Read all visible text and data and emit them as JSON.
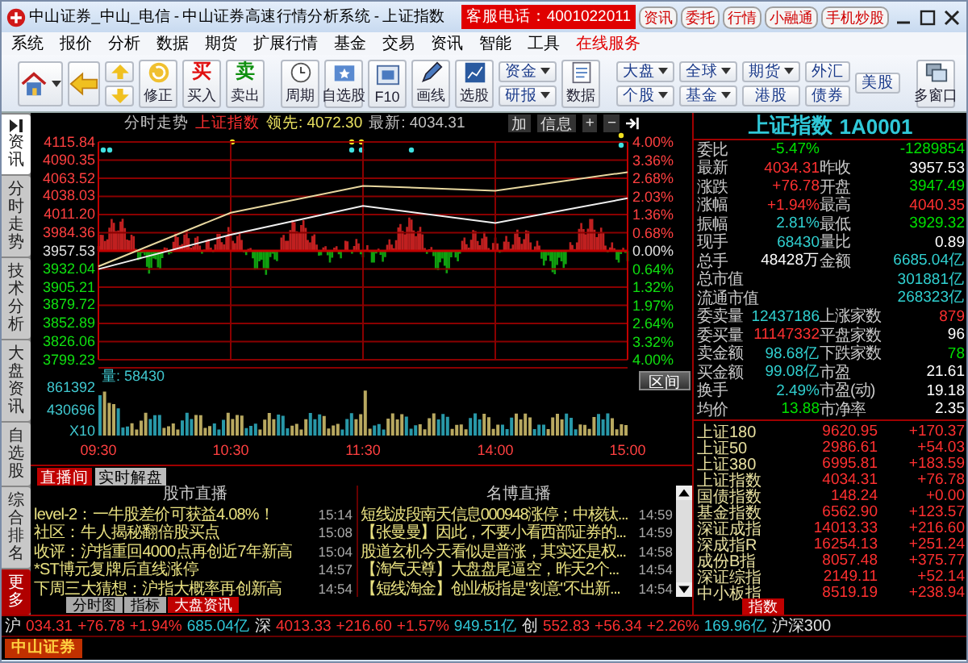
{
  "window": {
    "title": "中山证券_中山_电信 - 中山证券高速行情分析系统 - 上证指数",
    "hotline": "客服电话：4001022011",
    "quick_buttons": [
      "资讯",
      "委托",
      "行情",
      "小融通",
      "手机炒股"
    ]
  },
  "menu": [
    {
      "label": "系统",
      "kind": "normal"
    },
    {
      "label": "报价",
      "kind": "normal"
    },
    {
      "label": "分析",
      "kind": "normal"
    },
    {
      "label": "数据",
      "kind": "normal"
    },
    {
      "label": "期货",
      "kind": "normal"
    },
    {
      "label": "扩展行情",
      "kind": "normal"
    },
    {
      "label": "基金",
      "kind": "normal"
    },
    {
      "label": "交易",
      "kind": "normal"
    },
    {
      "label": "资讯",
      "kind": "normal"
    },
    {
      "label": "智能",
      "kind": "normal"
    },
    {
      "label": "工具",
      "kind": "normal"
    },
    {
      "label": "在线服务",
      "kind": "highlight"
    }
  ],
  "toolbar": [
    {
      "kind": "home"
    },
    {
      "kind": "back"
    },
    {
      "kind": "updown"
    },
    {
      "kind": "labeled",
      "label": "修正"
    },
    {
      "kind": "trade",
      "glyph": "买",
      "label": "买入",
      "color": "#e01010"
    },
    {
      "kind": "trade",
      "glyph": "卖",
      "label": "卖出",
      "color": "#109010"
    },
    {
      "kind": "separator"
    },
    {
      "kind": "labeled",
      "label": "周期"
    },
    {
      "kind": "labeled",
      "label": "自选股"
    },
    {
      "kind": "labeled",
      "label": "F10"
    },
    {
      "kind": "labeled",
      "label": "画线"
    },
    {
      "kind": "labeled",
      "label": "选股"
    },
    {
      "kind": "pair",
      "items": [
        {
          "label": "资金",
          "dropdown": true
        },
        {
          "label": "研报",
          "dropdown": true
        }
      ]
    },
    {
      "kind": "labeled",
      "label": "数据"
    },
    {
      "kind": "separator"
    },
    {
      "kind": "pair",
      "items": [
        {
          "label": "大盘",
          "dropdown": true
        },
        {
          "label": "个股",
          "dropdown": true
        }
      ]
    },
    {
      "kind": "pair",
      "items": [
        {
          "label": "全球",
          "dropdown": true
        },
        {
          "label": "基金",
          "dropdown": true
        }
      ]
    },
    {
      "kind": "pair",
      "items": [
        {
          "label": "期货",
          "dropdown": true
        },
        {
          "label": "港股",
          "dropdown": false
        }
      ]
    },
    {
      "kind": "pair",
      "items": [
        {
          "label": "外汇",
          "dropdown": false
        },
        {
          "label": "债券",
          "dropdown": false
        }
      ]
    },
    {
      "kind": "pair",
      "items": [
        {
          "label": "美股",
          "dropdown": false
        }
      ]
    },
    {
      "kind": "separator"
    },
    {
      "kind": "labeled",
      "label": "多窗口"
    }
  ],
  "left_tabs": [
    {
      "label": "资讯",
      "kind": "tab",
      "selected": true
    },
    {
      "label": "分时走势",
      "kind": "tab",
      "selected": false
    },
    {
      "label": "技术分析",
      "kind": "tab",
      "selected": false
    },
    {
      "label": "大盘资讯",
      "kind": "tab",
      "selected": false
    },
    {
      "label": "自选股",
      "kind": "tab",
      "selected": false
    },
    {
      "label": "综合排名",
      "kind": "tab",
      "selected": false
    },
    {
      "label": "更多",
      "kind": "more",
      "selected": false
    }
  ],
  "chart": {
    "title": "分时走势",
    "symbol": "上证指数",
    "lead_value": "4072.30",
    "latest_value": "4034.31",
    "tools": [
      "加",
      "信息",
      "+",
      "−"
    ],
    "chart_data": {
      "type": "line",
      "x": [
        "09:30",
        "10:30",
        "11:30",
        "14:00",
        "15:00"
      ],
      "series": [
        {
          "name": "领先:",
          "color": "#e8d8a0",
          "values": [
            3935,
            4013,
            4052,
            4045,
            4072
          ]
        },
        {
          "name": "最新:",
          "color": "#f0f0f0",
          "values": [
            3931,
            3981,
            4023,
            3998,
            4034
          ]
        }
      ],
      "ylim": [
        3799.23,
        4115.84
      ],
      "grid": true,
      "ref_lines": [
        {
          "axis": "y",
          "value": 3957.53
        }
      ],
      "yticks": [
        {
          "value": 4115.84,
          "label": "4115.84"
        },
        {
          "value": 4090.35,
          "label": "4090.35"
        },
        {
          "value": 4063.52,
          "label": "4063.52"
        },
        {
          "value": 4038.03,
          "label": "4038.03"
        },
        {
          "value": 4011.2,
          "label": "4011.20"
        },
        {
          "value": 3984.36,
          "label": "3984.36"
        },
        {
          "value": 3957.53,
          "label": "3957.53"
        },
        {
          "value": 3932.04,
          "label": "3932.04"
        },
        {
          "value": 3905.21,
          "label": "3905.21"
        },
        {
          "value": 3879.72,
          "label": "3879.72"
        },
        {
          "value": 3852.89,
          "label": "3852.89"
        },
        {
          "value": 3826.06,
          "label": "3826.06"
        },
        {
          "value": 3799.23,
          "label": "3799.23"
        }
      ]
    },
    "percent_labels": [
      "4.00%",
      "3.36%",
      "2.68%",
      "2.03%",
      "1.36%",
      "0.68%",
      "0.00%",
      "0.64%",
      "1.32%",
      "1.97%",
      "2.64%",
      "3.32%",
      "4.00%"
    ],
    "volume_label": "量: 58430",
    "volume_labels": [
      "861392",
      "430696"
    ],
    "multiplier": "X10",
    "range_button": "区间"
  },
  "news": {
    "tabs": [
      {
        "label": "直播间",
        "selected": true
      },
      {
        "label": "实时解盘",
        "selected": false
      }
    ],
    "left": {
      "title": "股市直播",
      "items": [
        {
          "text": "level-2：一牛股差价可获益4.08%！",
          "time": "15:14"
        },
        {
          "text": "社区：牛人揭秘翻倍股买点",
          "time": "15:08"
        },
        {
          "text": "收评：沪指重回4000点再创近7年新高",
          "time": "15:04"
        },
        {
          "text": "*ST博元复牌后直线涨停",
          "time": "14:57"
        },
        {
          "text": "下周三大猜想：沪指大概率再创新高",
          "time": "14:54"
        }
      ]
    },
    "right": {
      "title": "名博直播",
      "items": [
        {
          "text": "短线波段南天信息000948涨停；中核钛...",
          "time": "14:59"
        },
        {
          "text": "【张曼曼】因此，不要小看西部证券的...",
          "time": "14:59"
        },
        {
          "text": "股道玄机今天看似是普涨，其实还是权...",
          "time": "14:58"
        },
        {
          "text": "【淘气天尊】大盘盘尾逼空，昨天2个...",
          "time": "14:54"
        },
        {
          "text": "【短线淘金】创业板指是\"刻意\"不出新...",
          "time": "14:54"
        }
      ]
    },
    "bottom_tabs": [
      {
        "label": "分时图",
        "selected": false
      },
      {
        "label": "指标",
        "selected": false
      },
      {
        "label": "大盘资讯",
        "selected": true
      }
    ]
  },
  "quote": {
    "title": "上证指数",
    "code": "1A0001",
    "rows": [
      {
        "kind": "pair",
        "cells": [
          {
            "text": "委比"
          },
          {
            "text": "-5.47%",
            "color": "#00e000"
          },
          {
            "text": ""
          },
          {
            "text": "-1289854",
            "color": "#00e000"
          }
        ]
      },
      {
        "kind": "pair",
        "cells": [
          {
            "text": "最新"
          },
          {
            "text": "4034.31",
            "color": "#ff3030"
          },
          {
            "text": "昨收"
          },
          {
            "text": "3957.53",
            "color": "#ffffff"
          }
        ]
      },
      {
        "kind": "pair",
        "cells": [
          {
            "text": "涨跌"
          },
          {
            "text": "+76.78",
            "color": "#ff3030"
          },
          {
            "text": "开盘"
          },
          {
            "text": "3947.49",
            "color": "#00e000"
          }
        ]
      },
      {
        "kind": "pair",
        "cells": [
          {
            "text": "涨幅"
          },
          {
            "text": "+1.94%",
            "color": "#ff3030"
          },
          {
            "text": "最高"
          },
          {
            "text": "4040.35",
            "color": "#ff3030"
          }
        ]
      },
      {
        "kind": "pair",
        "cells": [
          {
            "text": "振幅"
          },
          {
            "text": "2.81%",
            "color": "#30d0d0"
          },
          {
            "text": "最低"
          },
          {
            "text": "3929.32",
            "color": "#00e000"
          }
        ]
      },
      {
        "kind": "pair",
        "cells": [
          {
            "text": "现手"
          },
          {
            "text": "68430",
            "color": "#30d0d0"
          },
          {
            "text": "量比"
          },
          {
            "text": "0.89",
            "color": "#ffffff"
          }
        ]
      },
      {
        "kind": "pair",
        "cells": [
          {
            "text": "总手"
          },
          {
            "text": "48428万",
            "color": "#ffffff"
          },
          {
            "text": "金额"
          },
          {
            "text": "6685.04亿",
            "color": "#30d0d0"
          }
        ]
      },
      {
        "kind": "wide",
        "cells": [
          {
            "text": "总市值"
          },
          {
            "text": "301881亿",
            "color": "#30d0d0"
          }
        ]
      },
      {
        "kind": "wide",
        "cells": [
          {
            "text": "流通市值"
          },
          {
            "text": "268323亿",
            "color": "#30d0d0"
          }
        ]
      },
      {
        "kind": "pair",
        "cells": [
          {
            "text": "委卖量"
          },
          {
            "text": "12437186",
            "color": "#30d0d0"
          },
          {
            "text": "上涨家数"
          },
          {
            "text": "879",
            "color": "#ff3030"
          }
        ]
      },
      {
        "kind": "pair",
        "cells": [
          {
            "text": "委买量"
          },
          {
            "text": "11147332",
            "color": "#ff3030"
          },
          {
            "text": "平盘家数"
          },
          {
            "text": "96",
            "color": "#ffffff"
          }
        ]
      },
      {
        "kind": "pair",
        "cells": [
          {
            "text": "卖金额"
          },
          {
            "text": "98.68亿",
            "color": "#30d0d0"
          },
          {
            "text": "下跌家数"
          },
          {
            "text": "78",
            "color": "#00e000"
          }
        ]
      },
      {
        "kind": "pair",
        "cells": [
          {
            "text": "买金额"
          },
          {
            "text": "99.08亿",
            "color": "#30d0d0"
          },
          {
            "text": "市盈"
          },
          {
            "text": "21.61",
            "color": "#ffffff"
          }
        ]
      },
      {
        "kind": "pair",
        "cells": [
          {
            "text": "换手"
          },
          {
            "text": "2.49%",
            "color": "#30d0d0"
          },
          {
            "text": "市盈(动)"
          },
          {
            "text": "19.18",
            "color": "#ffffff"
          }
        ]
      },
      {
        "kind": "pair",
        "cells": [
          {
            "text": "均价"
          },
          {
            "text": "13.88",
            "color": "#00e000"
          },
          {
            "text": "市净率"
          },
          {
            "text": "2.35",
            "color": "#ffffff"
          }
        ]
      }
    ]
  },
  "indices": [
    {
      "name": "上证180",
      "value": "9620.95",
      "change": "+170.37"
    },
    {
      "name": "上证50",
      "value": "2986.61",
      "change": "+54.03"
    },
    {
      "name": "上证380",
      "value": "6995.81",
      "change": "+183.59"
    },
    {
      "name": "上证指数",
      "value": "4034.31",
      "change": "+76.78"
    },
    {
      "name": "国债指数",
      "value": "148.24",
      "change": "+0.00"
    },
    {
      "name": "基金指数",
      "value": "6562.90",
      "change": "+123.57"
    },
    {
      "name": "深证成指",
      "value": "14013.33",
      "change": "+216.60"
    },
    {
      "name": "深成指R",
      "value": "16254.13",
      "change": "+251.24"
    },
    {
      "name": "成份B指",
      "value": "8057.48",
      "change": "+375.77"
    },
    {
      "name": "深证综指",
      "value": "2149.11",
      "change": "+52.14"
    },
    {
      "name": "中小板指",
      "value": "8519.19",
      "change": "+238.94"
    }
  ],
  "index_tabs": [
    {
      "label": "指数",
      "selected": true
    }
  ],
  "ticker": [
    {
      "label": "沪",
      "value": "034.31",
      "change": "+76.78",
      "pct": "+1.94%",
      "amount": "685.04亿"
    },
    {
      "label": "深",
      "value": "4013.33",
      "change": "+216.60",
      "pct": "+1.57%",
      "amount": "949.51亿"
    },
    {
      "label": "创",
      "value": "552.83",
      "change": "+56.34",
      "pct": "+2.26%",
      "amount": "169.96亿"
    },
    {
      "label": "沪深300"
    }
  ],
  "status_bar": {
    "logo": "中山证券"
  }
}
